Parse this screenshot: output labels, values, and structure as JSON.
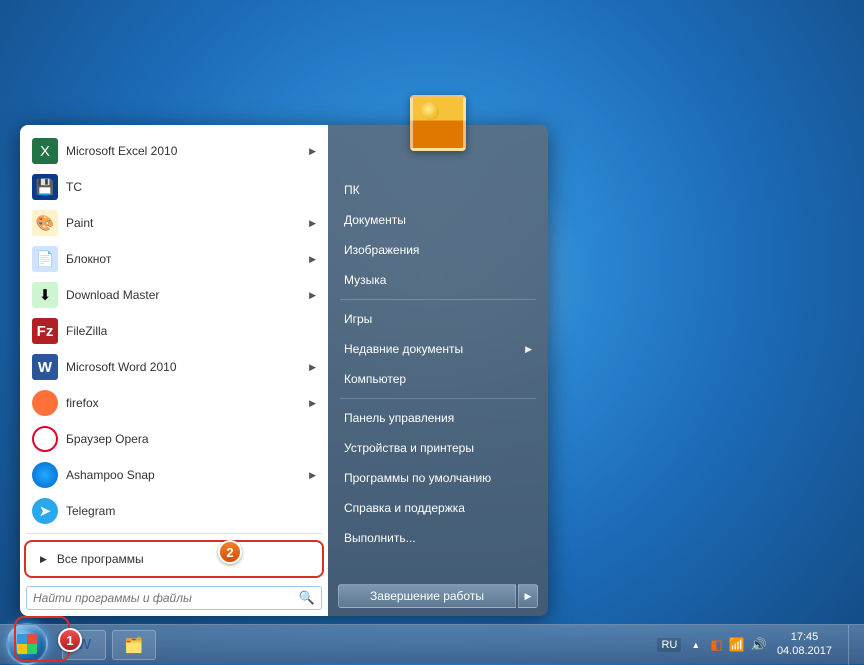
{
  "start": {
    "programs": [
      {
        "label": "Microsoft Excel 2010",
        "icon_cls": "ic-excel",
        "glyph": "X",
        "arrow": true
      },
      {
        "label": "TC",
        "icon_cls": "ic-tc",
        "glyph": "💾",
        "arrow": false
      },
      {
        "label": "Paint",
        "icon_cls": "ic-paint",
        "glyph": "🎨",
        "arrow": true
      },
      {
        "label": "Блокнот",
        "icon_cls": "ic-notepad",
        "glyph": "📄",
        "arrow": true
      },
      {
        "label": "Download Master",
        "icon_cls": "ic-dm",
        "glyph": "⬇",
        "arrow": true
      },
      {
        "label": "FileZilla",
        "icon_cls": "ic-fz",
        "glyph": "Fz",
        "arrow": false
      },
      {
        "label": "Microsoft Word 2010",
        "icon_cls": "ic-word",
        "glyph": "W",
        "arrow": true
      },
      {
        "label": "firefox",
        "icon_cls": "ic-ff",
        "glyph": "",
        "arrow": true
      },
      {
        "label": "Браузер Opera",
        "icon_cls": "ic-opera",
        "glyph": "",
        "arrow": false
      },
      {
        "label": "Ashampoo Snap",
        "icon_cls": "ic-snap",
        "glyph": "",
        "arrow": true
      },
      {
        "label": "Telegram",
        "icon_cls": "ic-tg",
        "glyph": "➤",
        "arrow": false
      }
    ],
    "all_programs": "Все программы",
    "search_placeholder": "Найти программы и файлы"
  },
  "right": {
    "items": [
      {
        "label": "ПК",
        "arrow": false
      },
      {
        "label": "Документы",
        "arrow": false
      },
      {
        "label": "Изображения",
        "arrow": false
      },
      {
        "label": "Музыка",
        "arrow": false
      },
      {
        "divider": true
      },
      {
        "label": "Игры",
        "arrow": false
      },
      {
        "label": "Недавние документы",
        "arrow": true
      },
      {
        "label": "Компьютер",
        "arrow": false
      },
      {
        "divider": true
      },
      {
        "label": "Панель управления",
        "arrow": false
      },
      {
        "label": "Устройства и принтеры",
        "arrow": false
      },
      {
        "label": "Программы по умолчанию",
        "arrow": false
      },
      {
        "label": "Справка и поддержка",
        "arrow": false
      },
      {
        "label": "Выполнить...",
        "arrow": false
      }
    ],
    "shutdown": "Завершение работы"
  },
  "annotations": {
    "badge1": "1",
    "badge2": "2"
  },
  "tray": {
    "lang": "RU",
    "time": "17:45",
    "date": "04.08.2017"
  }
}
